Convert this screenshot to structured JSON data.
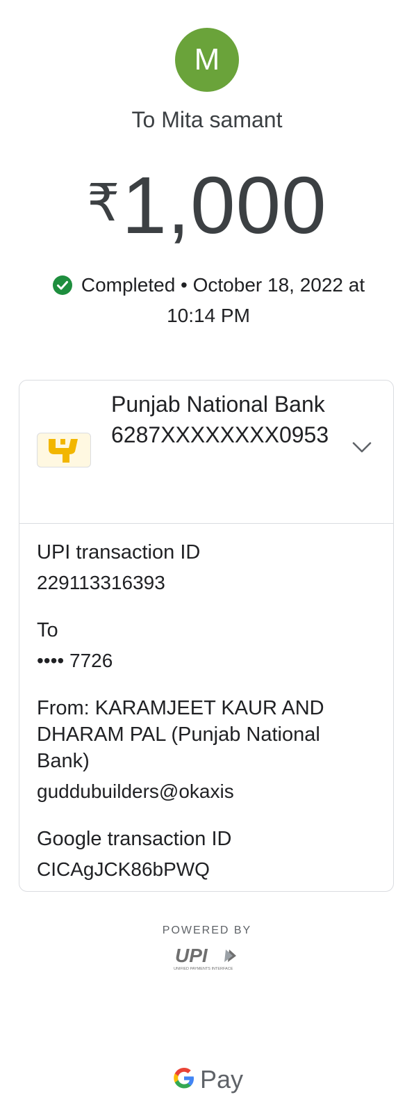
{
  "recipient": {
    "avatar_letter": "M",
    "to_label": "To Mita samant"
  },
  "payment": {
    "currency_symbol": "₹",
    "amount": "1,000",
    "status_text": "Completed • October 18, 2022 at 10:14 PM"
  },
  "bank": {
    "name": "Punjab National Bank",
    "account": "6287XXXXXXXX0953"
  },
  "details": {
    "upi_label": "UPI transaction ID",
    "upi_value": "229113316393",
    "to_label": "To",
    "to_value": "•••• 7726",
    "from_label": "From: KARAMJEET KAUR AND DHARAM PAL (Punjab National Bank)",
    "from_value": "guddubuilders@okaxis",
    "google_label": "Google transaction ID",
    "google_value": "CICAgJCK86bPWQ"
  },
  "footer": {
    "powered_by": "POWERED BY",
    "upi_logo_text": "UPI",
    "upi_tagline": "UNIFIED PAYMENTS INTERFACE",
    "brand_pay": "Pay"
  },
  "colors": {
    "avatar": "#6aa33a",
    "success": "#1e8e3e",
    "bank_logo": "#f2b600"
  }
}
